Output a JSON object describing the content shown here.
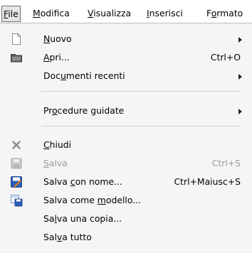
{
  "menubar": {
    "items": [
      {
        "pre": "",
        "acc": "F",
        "post": "ile"
      },
      {
        "pre": "",
        "acc": "M",
        "post": "odifica"
      },
      {
        "pre": "",
        "acc": "V",
        "post": "isualizza"
      },
      {
        "pre": "",
        "acc": "I",
        "post": "nserisci"
      },
      {
        "pre": "F",
        "acc": "o",
        "post": "rmato"
      }
    ]
  },
  "menu": {
    "nuovo": {
      "pre": "",
      "acc": "N",
      "post": "uovo",
      "icon": "new-document-icon"
    },
    "apri": {
      "pre": "",
      "acc": "A",
      "post": "pri...",
      "shortcut": "Ctrl+O",
      "icon": "open-folder-icon"
    },
    "recenti": {
      "pre": "Doc",
      "acc": "u",
      "post": "menti recenti"
    },
    "procedure": {
      "pre": "Pr",
      "acc": "o",
      "post": "cedure guidate"
    },
    "chiudi": {
      "pre": "",
      "acc": "C",
      "post": "hiudi",
      "icon": "close-x-icon"
    },
    "salva": {
      "pre": "",
      "acc": "S",
      "post": "alva",
      "shortcut": "Ctrl+S",
      "icon": "save-disk-icon"
    },
    "salva_nome": {
      "pre": "Salva ",
      "acc": "c",
      "post": "on nome...",
      "shortcut": "Ctrl+Maiusc+S",
      "icon": "save-as-icon"
    },
    "salva_modello": {
      "pre": "Salva come ",
      "acc": "m",
      "post": "odello...",
      "icon": "save-template-icon"
    },
    "salva_copia": {
      "pre": "Sa",
      "acc": "l",
      "post": "va una copia..."
    },
    "salva_tutto": {
      "pre": "Sal",
      "acc": "v",
      "post": "a tutto"
    }
  }
}
